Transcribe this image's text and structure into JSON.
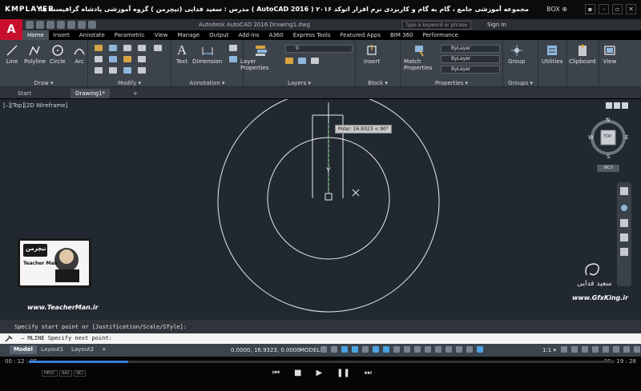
{
  "player": {
    "logo": "KMPLAYER",
    "title": "مجموعه آموزشی جامع ، گام به گام و کاربردی نرم افزار اتوکد ۲۰۱۶ ( AutoCAD 2016 ) مدرس : سعید فدایی (تیچرمن ) گروه آموزشی پادشاه گرافیست ها",
    "box_label": "BOX ⊕",
    "time_elapsed": "00 : 12 : 05",
    "time_total": "00 : 19 : 28",
    "progress": 0.17,
    "badges": [
      "HEVC",
      "AAC",
      "NCI"
    ]
  },
  "acad": {
    "logo": "A",
    "title": "Autodesk AutoCAD 2016    Drawing1.dwg",
    "search_placeholder": "Type a keyword or phrase",
    "sign_in": "Sign In",
    "tabs": [
      "Home",
      "Insert",
      "Annotate",
      "Parametric",
      "View",
      "Manage",
      "Output",
      "Add-ins",
      "A360",
      "Express Tools",
      "Featured Apps",
      "BIM 360",
      "Performance"
    ],
    "active_tab": "Home",
    "ribbon": {
      "draw": {
        "title": "Draw ▾",
        "tools": [
          "Line",
          "Polyline",
          "Circle",
          "Arc"
        ]
      },
      "modify": {
        "title": "Modify ▾"
      },
      "annotation": {
        "title": "Annotation ▾",
        "tools": [
          "Text",
          "Dimension"
        ]
      },
      "layers": {
        "title": "Layers ▾",
        "tool": "Layer Properties",
        "layer_value": "0"
      },
      "block": {
        "title": "Block ▾",
        "tool": "Insert"
      },
      "properties": {
        "title": "Properties ▾",
        "tool": "Match Properties",
        "bylayer": [
          "ByLayer",
          "ByLayer",
          "ByLayer"
        ]
      },
      "groups": {
        "title": "Groups ▾",
        "tool": "Group"
      },
      "utilities": {
        "tool": "Utilities"
      },
      "clipboard": {
        "tool": "Clipboard"
      },
      "view": {
        "tool": "View"
      }
    },
    "file_tabs": [
      "Start",
      "Drawing1*"
    ],
    "viewport_label": "[–][Top][2D Wireframe]",
    "polar_tooltip": "Polar: 16.9323 < 90°",
    "viewcube": {
      "face": "TOP",
      "n": "N",
      "s": "S",
      "e": "E",
      "w": "W",
      "wcs": "WCS"
    },
    "command_history": "Specify start point or [Justification/Scale/STyle]:",
    "command_prompt": "–  MLINE Specify next point:",
    "layout_tabs": [
      "Model",
      "Layout1",
      "Layout2",
      "+"
    ],
    "coords": "0.0000, 16.9323, 0.0000",
    "model_label": "MODEL",
    "scale": "1:1 ▾"
  },
  "overlay": {
    "teacher_logo_text": "تیچرمن",
    "teacher_name": "Teacher Man",
    "teacher_url": "www.TeacherMan.ir",
    "gfx_signature": "سعید فدایی",
    "gfx_url": "www.GfxKing.ir"
  }
}
